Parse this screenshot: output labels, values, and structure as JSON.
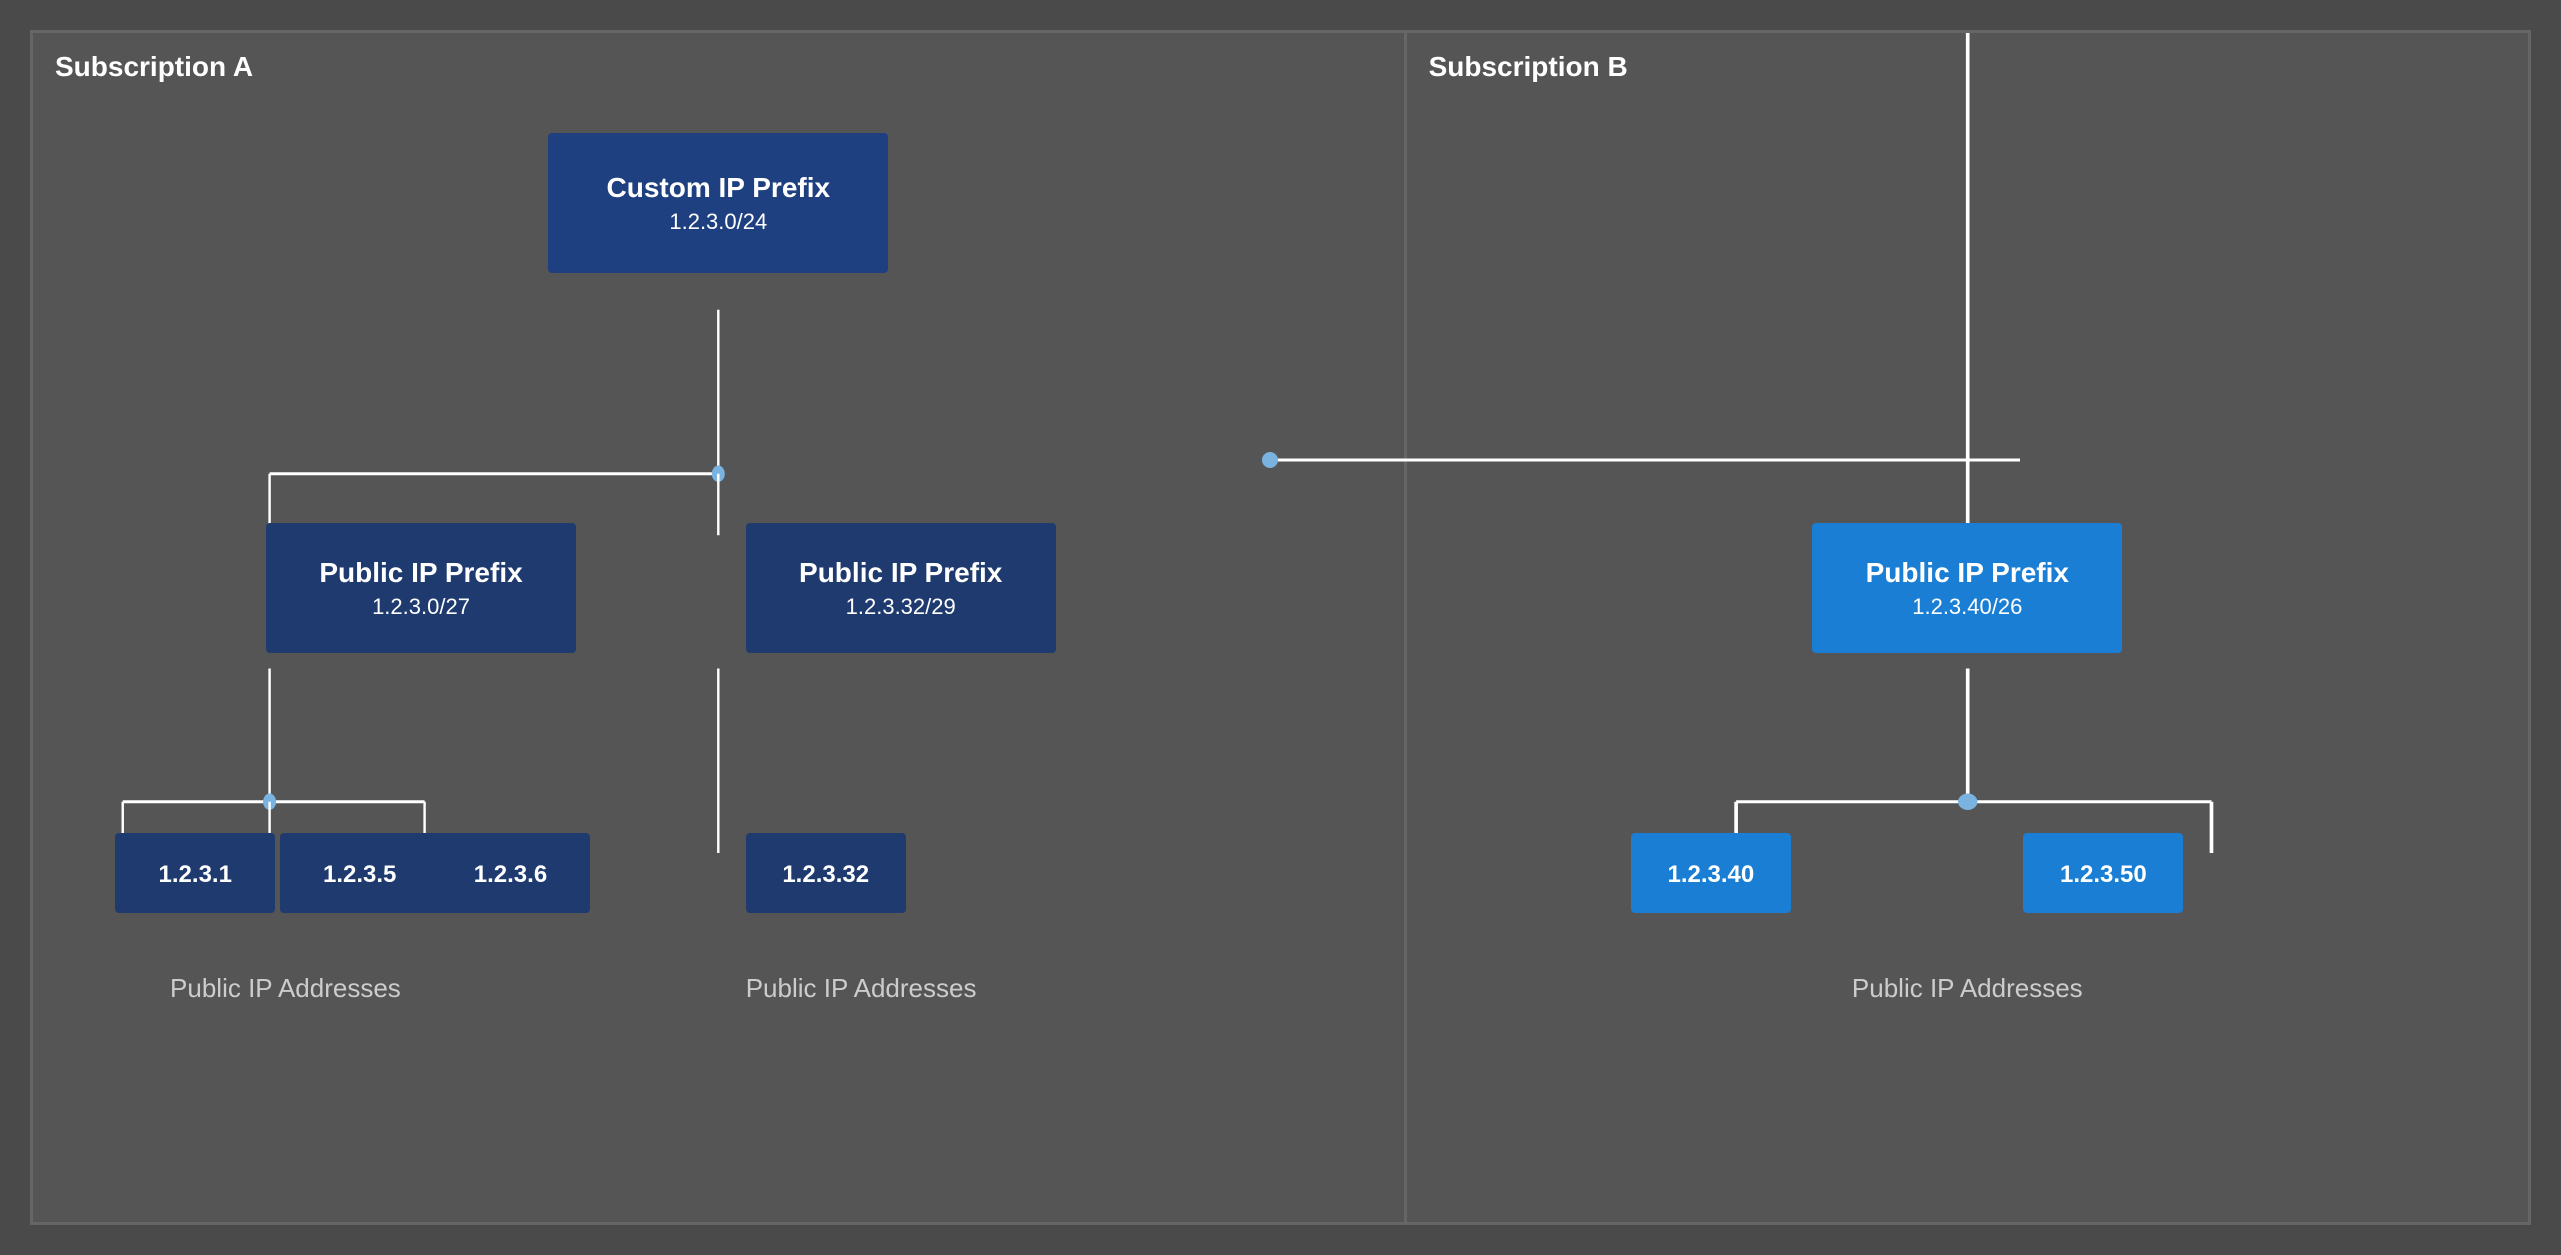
{
  "subscriptionA": {
    "label": "Subscription A",
    "customPrefix": {
      "title": "Custom IP Prefix",
      "subtitle": "1.2.3.0/24"
    },
    "prefixes": [
      {
        "title": "Public IP Prefix",
        "subtitle": "1.2.3.0/27",
        "ips": [
          "1.2.3.1",
          "1.2.3.5",
          "1.2.3.6"
        ],
        "ipsLabel": "Public IP Addresses"
      },
      {
        "title": "Public IP Prefix",
        "subtitle": "1.2.3.32/29",
        "ips": [
          "1.2.3.32"
        ],
        "ipsLabel": "Public IP Addresses"
      }
    ]
  },
  "subscriptionB": {
    "label": "Subscription B",
    "prefixes": [
      {
        "title": "Public IP Prefix",
        "subtitle": "1.2.3.40/26",
        "ips": [
          "1.2.3.40",
          "1.2.3.50"
        ],
        "ipsLabel": "Public IP Addresses"
      }
    ]
  }
}
